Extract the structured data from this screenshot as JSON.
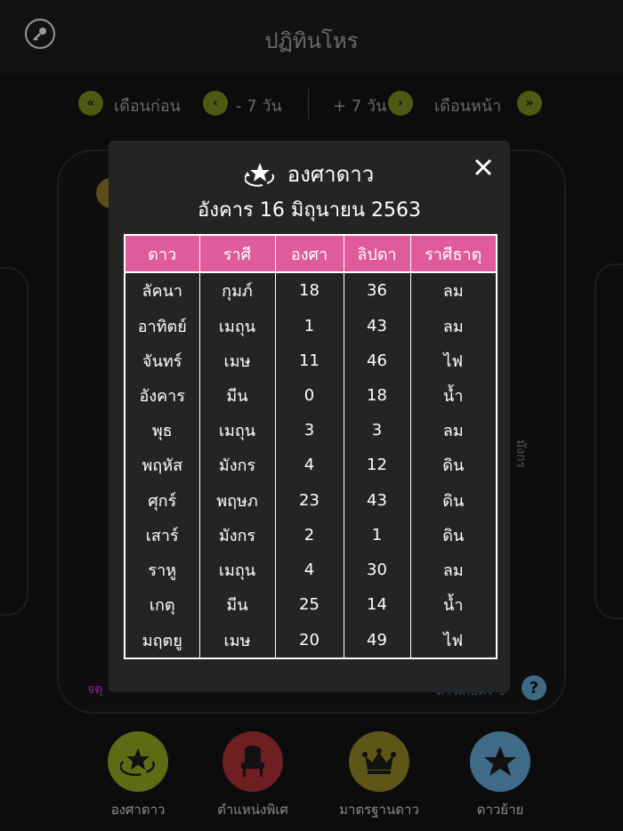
{
  "header": {
    "title": "ปฏิทินโหร"
  },
  "nav": {
    "prev_month": "เดือนก่อน",
    "minus_week": "- 7 วัน",
    "plus_week": "+ 7 วัน",
    "next_month": "เดือนหน้า"
  },
  "background": {
    "vertical_text": "มังกร",
    "bottom_left_text": "จตุ",
    "bottom_right_text": "ดาวเกษตร ซึ่"
  },
  "modal": {
    "title": "องศาดาว",
    "date": "อังคาร 16 มิถุนายน 2563",
    "columns": [
      "ดาว",
      "ราศี",
      "องศา",
      "ลิปดา",
      "ราศีธาตุ"
    ],
    "rows": [
      [
        "ลัคนา",
        "กุมภ์",
        "18",
        "36",
        "ลม"
      ],
      [
        "อาทิตย์",
        "เมถุน",
        "1",
        "43",
        "ลม"
      ],
      [
        "จันทร์",
        "เมษ",
        "11",
        "46",
        "ไฟ"
      ],
      [
        "อังคาร",
        "มีน",
        "0",
        "18",
        "น้ำ"
      ],
      [
        "พุธ",
        "เมถุน",
        "3",
        "3",
        "ลม"
      ],
      [
        "พฤหัส",
        "มังกร",
        "4",
        "12",
        "ดิน"
      ],
      [
        "ศุกร์",
        "พฤษภ",
        "23",
        "43",
        "ดิน"
      ],
      [
        "เสาร์",
        "มังกร",
        "2",
        "1",
        "ดิน"
      ],
      [
        "ราหู",
        "เมถุน",
        "4",
        "30",
        "ลม"
      ],
      [
        "เกตุ",
        "มีน",
        "25",
        "14",
        "น้ำ"
      ],
      [
        "มฤตยู",
        "เมษ",
        "20",
        "49",
        "ไฟ"
      ]
    ]
  },
  "bottom_nav": [
    {
      "label": "องศาดาว",
      "icon": "rotating-star-icon",
      "color": "#5e6b14"
    },
    {
      "label": "ตำแหน่งพิเศ",
      "icon": "throne-chair-icon",
      "color": "#6e1f22"
    },
    {
      "label": "มาตรฐานดาว",
      "icon": "crown-icon",
      "color": "#5e5616"
    },
    {
      "label": "ดาวย้าย",
      "icon": "star-icon",
      "color": "#3f6b88"
    }
  ],
  "colors": {
    "table_header": "#e05b9c",
    "modal_bg": "#242424",
    "page_bg": "#0c0c0c"
  }
}
